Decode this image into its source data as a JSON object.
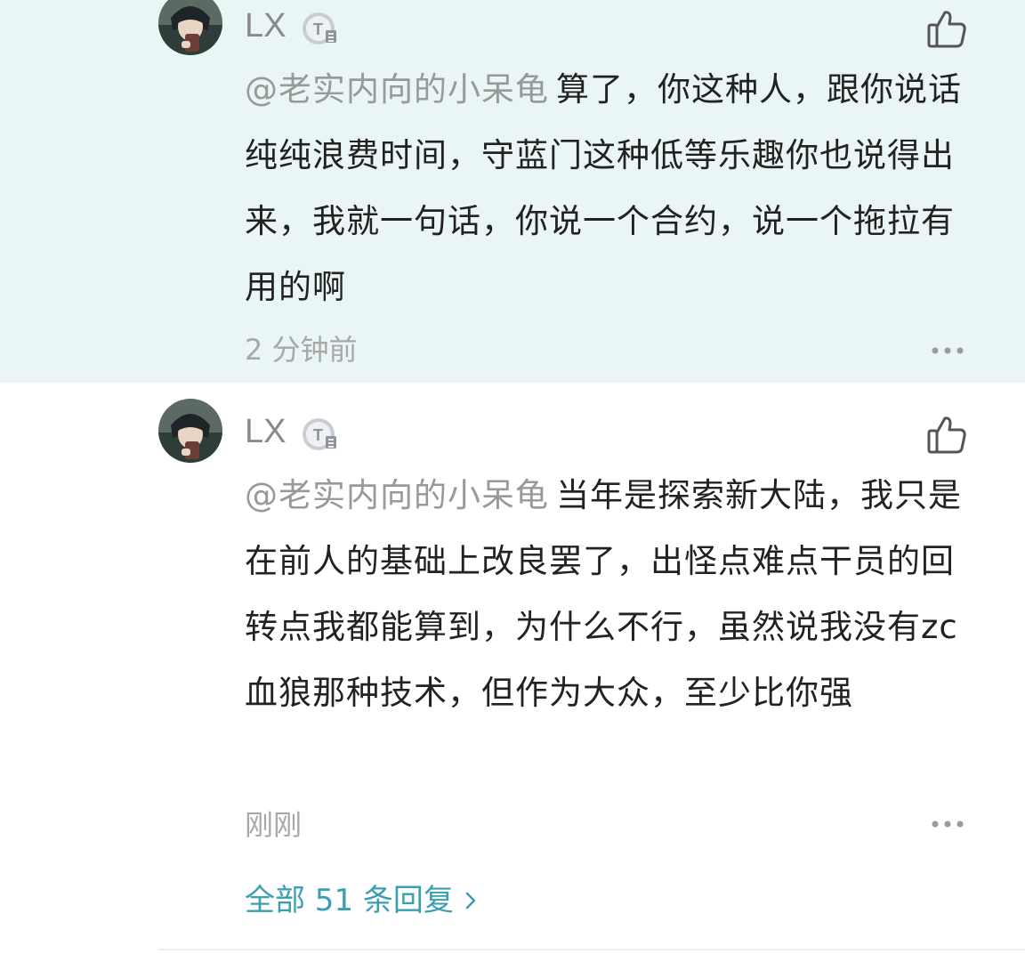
{
  "colors": {
    "highlight_bg": "#e9f6f5",
    "link": "#3a9fb3",
    "mention": "#999999",
    "text": "#222222",
    "meta": "#a8a8a8"
  },
  "replies": [
    {
      "username": "LX",
      "badge_icon": "t-level-badge-icon",
      "mention": "@老实内向的小呆龟",
      "text": "算了，你这种人，跟你说话纯纯浪费时间，守蓝门这种低等乐趣你也说得出来，我就一句话，你说一个合约，说一个拖拉有用的啊",
      "time": "2 分钟前",
      "highlighted": true
    },
    {
      "username": "LX",
      "badge_icon": "t-level-badge-icon",
      "mention": "@老实内向的小呆龟",
      "text": "当年是探索新大陆，我只是在前人的基础上改良罢了，出怪点难点干员的回转点我都能算到，为什么不行，虽然说我没有zc血狼那种技术，但作为大众，至少比你强",
      "time": "刚刚",
      "highlighted": false
    }
  ],
  "footer": {
    "view_all_label": "全部 51 条回复"
  }
}
